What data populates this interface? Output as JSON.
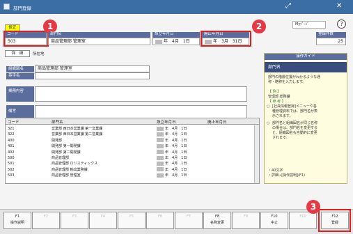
{
  "window": {
    "title": "部門登録"
  },
  "header": {
    "mypage": "Myﾍﾟｰｼﾞ",
    "help": "?",
    "mode": "修正"
  },
  "fields": {
    "code_label": "コード",
    "code_value": "503",
    "name_label": "部門名",
    "name_value": "商品管理部 管理室",
    "start_label": "設立年月日",
    "start_value": "年　4月　1日",
    "end_label": "廃止年月日",
    "end_value": "年　3月　31日",
    "count_label": "登録件数",
    "count_value": "25"
  },
  "tabs": {
    "detail": "詳　細",
    "location": "所在地"
  },
  "form": {
    "org_label": "組織図名",
    "org_value": "商品管理部 管理室",
    "eng_label": "英字名",
    "eng_value": "",
    "biz_label": "業務内容",
    "note_label": "備考"
  },
  "table": {
    "headers": [
      "コード",
      "部門名",
      "設立年月日",
      "廃止年月日"
    ],
    "rows": [
      {
        "code": "321",
        "name": "営業部 西日本営業課 第一営業課",
        "start": "年　4月　1日",
        "end": ""
      },
      {
        "code": "322",
        "name": "営業部 西日本営業課 第二営業課",
        "start": "年　4月　1日",
        "end": ""
      },
      {
        "code": "400",
        "name": "開発部",
        "start": "年　4月　1日",
        "end": ""
      },
      {
        "code": "401",
        "name": "開発部 第一開発課",
        "start": "年　4月　1日",
        "end": ""
      },
      {
        "code": "402",
        "name": "開発部 第二開発課",
        "start": "年　4月　1日",
        "end": ""
      },
      {
        "code": "500",
        "name": "商品管理部",
        "start": "年　4月　1日",
        "end": ""
      },
      {
        "code": "501",
        "name": "商品管理部 ロジスティックス",
        "start": "年　4月　1日",
        "end": ""
      },
      {
        "code": "502",
        "name": "商品管理部 輸出業務課",
        "start": "年　4月　1日",
        "end": ""
      },
      {
        "code": "503",
        "name": "商品管理部 管理室",
        "start": "年　4月　1日",
        "end": ""
      }
    ]
  },
  "guide": {
    "title": "操作ガイド",
    "heading": "部門名",
    "line1": "部門の階層位置がわかるような通",
    "line2": "称・略称を入力します。",
    "ex_label": "【 例 】",
    "ex_value": "管理部 総務課",
    "ref_label": "【 参 考 】",
    "ref1_1": "[社員情報登録]メニューや各",
    "ref1_2": "種管理資料では、部門名が表",
    "ref1_3": "示されます。",
    "ref2_1": "部門名と組織図名が同じ名称",
    "ref2_2": "の場合は、部門名を変更する",
    "ref2_3": "と、組織図名も自動的に変更",
    "ref2_4": "されます。",
    "foot1": "・40文字",
    "foot2": "・詳細→[操作説明](F1)"
  },
  "fkeys": [
    {
      "key": "F1",
      "label": "操作説明",
      "enabled": true
    },
    {
      "key": "F2",
      "label": "",
      "enabled": false
    },
    {
      "key": "F3",
      "label": "",
      "enabled": false
    },
    {
      "key": "F4",
      "label": "",
      "enabled": false
    },
    {
      "key": "F5",
      "label": "",
      "enabled": false
    },
    {
      "key": "F6",
      "label": "",
      "enabled": false
    },
    {
      "key": "F7",
      "label": "",
      "enabled": false
    },
    {
      "key": "F8",
      "label": "名称変更",
      "enabled": true
    },
    {
      "key": "F9",
      "label": "",
      "enabled": false
    },
    {
      "key": "F10",
      "label": "中止",
      "enabled": true
    },
    {
      "key": "F11",
      "label": "",
      "enabled": false
    },
    {
      "key": "F12",
      "label": "登録",
      "enabled": true
    }
  ],
  "callouts": [
    "1",
    "2",
    "3"
  ]
}
